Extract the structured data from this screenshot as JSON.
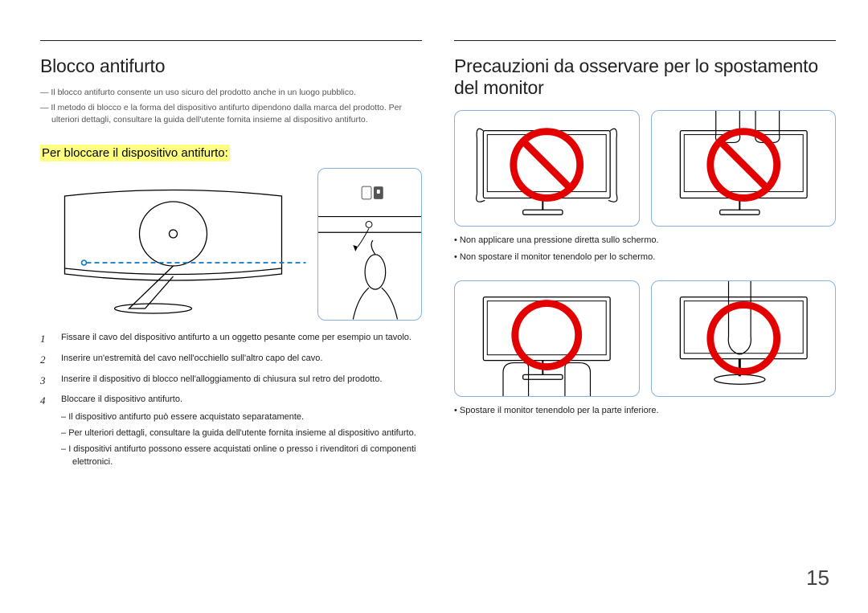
{
  "left": {
    "title": "Blocco antifurto",
    "note1": "Il blocco antifurto consente un uso sicuro del prodotto anche in un luogo pubblico.",
    "note2": "Il metodo di blocco e la forma del dispositivo antifurto dipendono dalla marca del prodotto. Per ulteriori dettagli, consultare la guida dell'utente fornita insieme al dispositivo antifurto.",
    "subheading": "Per bloccare il dispositivo antifurto:",
    "steps": [
      "Fissare il cavo del dispositivo antifurto a un oggetto pesante come per esempio un tavolo.",
      "Inserire un'estremità del cavo nell'occhiello sull'altro capo del cavo.",
      "Inserire il dispositivo di blocco nell'alloggiamento di chiusura sul retro del prodotto.",
      "Bloccare il dispositivo antifurto."
    ],
    "substeps": [
      "Il dispositivo antifurto può essere acquistato separatamente.",
      "Per ulteriori dettagli, consultare la guida dell'utente fornita insieme al dispositivo antifurto.",
      "I dispositivi antifurto possono essere acquistati online o presso i rivenditori di componenti elettronici."
    ]
  },
  "right": {
    "title": "Precauzioni da osservare per lo spostamento del monitor",
    "bullets1": [
      "Non applicare una pressione diretta sullo schermo.",
      "Non spostare il monitor tenendolo per lo schermo."
    ],
    "bullets2": [
      "Spostare il monitor tenendolo per la parte inferiore."
    ]
  },
  "page_number": "15"
}
